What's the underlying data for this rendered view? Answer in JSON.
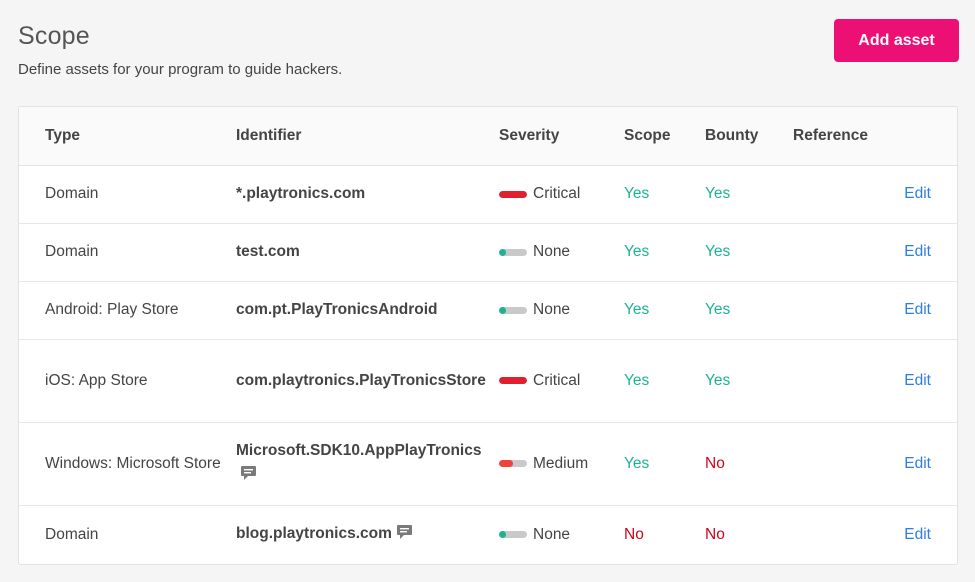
{
  "header": {
    "title": "Scope",
    "subtitle": "Define assets for your program to guide hackers.",
    "add_button": "Add asset"
  },
  "table": {
    "columns": [
      "Type",
      "Identifier",
      "Severity",
      "Scope",
      "Bounty",
      "Reference",
      ""
    ],
    "rows": [
      {
        "type": "Domain",
        "identifier": "*.playtronics.com",
        "has_comment": false,
        "severity": "Critical",
        "severity_level": 1.0,
        "severity_color": "#e0202e",
        "scope": "Yes",
        "bounty": "Yes",
        "reference": "",
        "action": "Edit"
      },
      {
        "type": "Domain",
        "identifier": "test.com",
        "has_comment": false,
        "severity": "None",
        "severity_level": 0.25,
        "severity_color": "#1cb395",
        "scope": "Yes",
        "bounty": "Yes",
        "reference": "",
        "action": "Edit"
      },
      {
        "type": "Android: Play Store",
        "identifier": "com.pt.PlayTronicsAndroid",
        "has_comment": false,
        "severity": "None",
        "severity_level": 0.25,
        "severity_color": "#1cb395",
        "scope": "Yes",
        "bounty": "Yes",
        "reference": "",
        "action": "Edit"
      },
      {
        "type": "iOS: App Store",
        "identifier": "com.playtronics.PlayTronicsStore",
        "has_comment": false,
        "severity": "Critical",
        "severity_level": 1.0,
        "severity_color": "#e0202e",
        "scope": "Yes",
        "bounty": "Yes",
        "reference": "",
        "action": "Edit"
      },
      {
        "type": "Windows: Microsoft Store",
        "identifier": "Microsoft.SDK10.AppPlayTronics",
        "has_comment": true,
        "severity": "Medium",
        "severity_level": 0.5,
        "severity_color": "#f0413b",
        "scope": "Yes",
        "bounty": "No",
        "reference": "",
        "action": "Edit"
      },
      {
        "type": "Domain",
        "identifier": "blog.playtronics.com",
        "has_comment": true,
        "severity": "None",
        "severity_level": 0.25,
        "severity_color": "#1cb395",
        "scope": "No",
        "bounty": "No",
        "reference": "",
        "action": "Edit"
      }
    ]
  },
  "colors": {
    "accent": "#ec1075",
    "yes": "#1cb395",
    "no": "#d0021b",
    "link": "#2f7de1"
  },
  "icons": {
    "comment": "comment-icon"
  }
}
